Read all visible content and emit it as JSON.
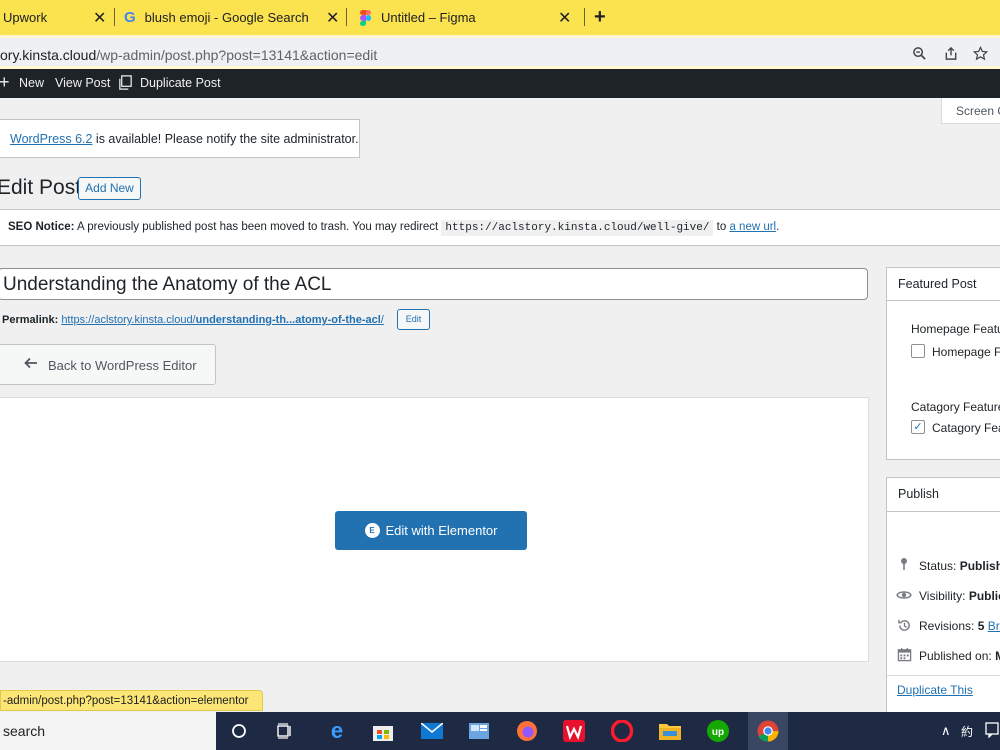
{
  "browser": {
    "tabs": [
      {
        "label": "Upwork",
        "favicon": "upwork-icon"
      },
      {
        "label": "blush emoji - Google Search",
        "favicon": "google-icon"
      },
      {
        "label": "Untitled – Figma",
        "favicon": "figma-icon"
      }
    ],
    "new_tab": "+",
    "close_glyph": "✕",
    "url_host": "ory.kinsta.cloud",
    "url_path": "/wp-admin/post.php?post=13141&action=edit"
  },
  "adminbar": {
    "plus": "+",
    "new": "New",
    "view_post": "View Post",
    "duplicate_post": "Duplicate Post"
  },
  "screen_options": "Screen O",
  "update_notice": {
    "link": "WordPress 6.2",
    "text": " is available! Please notify the site administrator."
  },
  "page": {
    "heading": "Edit Post",
    "add_new": "Add New"
  },
  "seo_notice": {
    "label": "SEO Notice:",
    "text": " A previously published post has been moved to trash. You may redirect ",
    "code": "https://aclstory.kinsta.cloud/well-give/",
    "to": " to ",
    "link": "a new url",
    "end": "."
  },
  "post": {
    "title": "Understanding the Anatomy of the ACL",
    "permalink_label": "Permalink:",
    "permalink_base": "https://aclstory.kinsta.cloud/",
    "permalink_slug": "understanding-th...atomy-of-the-acl",
    "permalink_end": "/",
    "edit_slug": "Edit",
    "back_button": "Back to WordPress Editor",
    "elementor_button": "Edit with Elementor",
    "elementor_logo": "E"
  },
  "sidebar": {
    "featured": {
      "title": "Featured Post",
      "homepage_label": "Homepage Featu",
      "homepage_checkbox": "Homepage Fe",
      "homepage_checked": false,
      "category_label": "Catagory Feature",
      "category_checkbox": "Catagory Feat",
      "category_checked": true
    },
    "publish": {
      "title": "Publish",
      "status_label": "Status:",
      "status_value": "Publishe",
      "visibility_label": "Visibility:",
      "visibility_value": "Public",
      "revisions_label": "Revisions:",
      "revisions_count": "5",
      "revisions_link": "Brow",
      "published_label": "Published on:",
      "published_value": "M",
      "duplicate": "Duplicate This"
    }
  },
  "statusbar_url": "-admin/post.php?post=13141&action=elementor",
  "taskbar": {
    "search": "search",
    "tray_up": "∧",
    "tray_ime": "約"
  },
  "colors": {
    "tab_bar": "#fbe24f",
    "admin_bar": "#1d2327",
    "wp_blue": "#2271b1",
    "taskbar": "#1e2a43"
  }
}
